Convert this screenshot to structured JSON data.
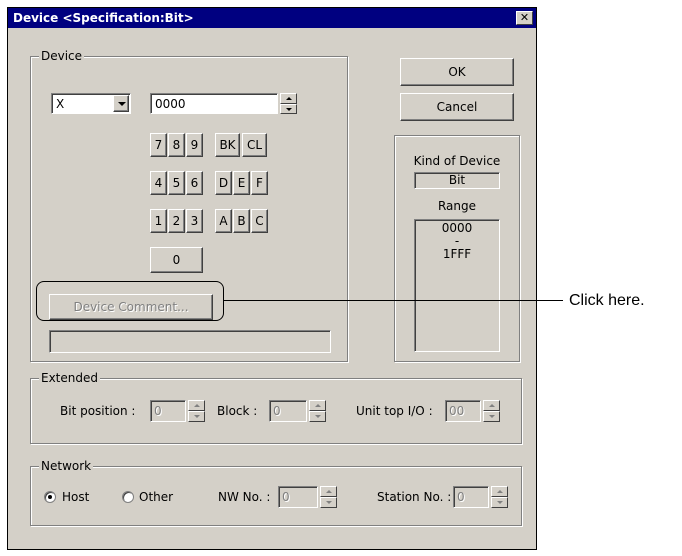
{
  "window": {
    "title": "Device <Specification:Bit>"
  },
  "device_group": {
    "label": "Device",
    "type_select": {
      "value": "X"
    },
    "number_input": {
      "value": "0000"
    },
    "keypad": {
      "row1": [
        "7",
        "8",
        "9"
      ],
      "row1_ops": [
        "BK",
        "CL"
      ],
      "row2": [
        "4",
        "5",
        "6"
      ],
      "row2_hex": [
        "D",
        "E",
        "F"
      ],
      "row3": [
        "1",
        "2",
        "3"
      ],
      "row3_hex": [
        "A",
        "B",
        "C"
      ],
      "zero": "0"
    },
    "comment_button": "Device Comment...",
    "comment_field": {
      "value": ""
    }
  },
  "buttons": {
    "ok": "OK",
    "cancel": "Cancel"
  },
  "kind_panel": {
    "label": "Kind of Device",
    "kind_value": "Bit",
    "range_label": "Range",
    "range_start": "0000",
    "range_sep": "-",
    "range_end": "1FFF"
  },
  "extended_group": {
    "label": "Extended",
    "bit_position_label": "Bit position :",
    "bit_position_value": "0",
    "block_label": "Block :",
    "block_value": "0",
    "unit_top_label": "Unit top I/O :",
    "unit_top_value": "00"
  },
  "network_group": {
    "label": "Network",
    "host_label": "Host",
    "other_label": "Other",
    "nw_no_label": "NW No. :",
    "nw_no_value": "0",
    "station_label": "Station No. :",
    "station_value": "0"
  },
  "annotation": {
    "text": "Click here."
  }
}
